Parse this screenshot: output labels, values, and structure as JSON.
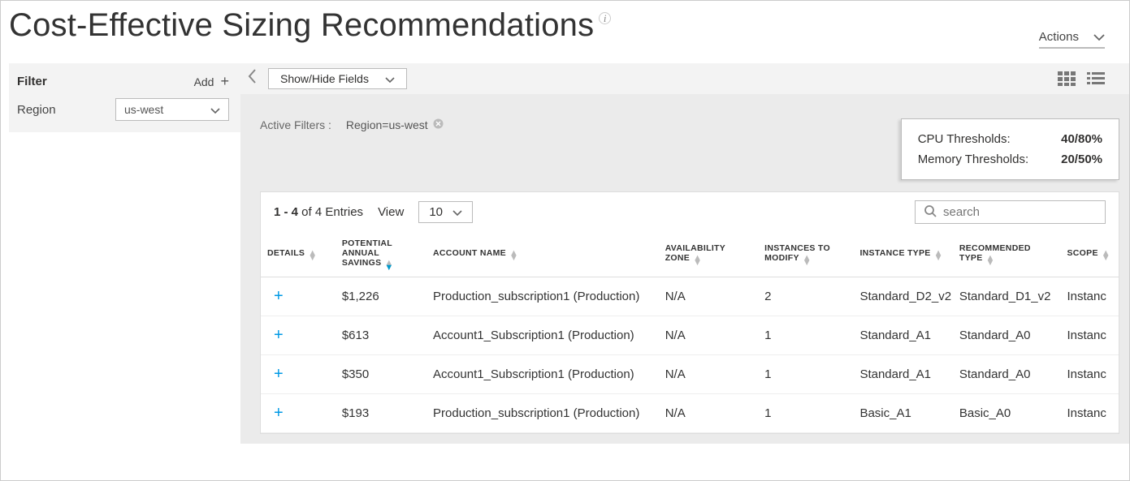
{
  "header": {
    "title": "Cost-Effective Sizing Recommendations",
    "actions_label": "Actions"
  },
  "filter": {
    "title": "Filter",
    "add_label": "Add",
    "region_label": "Region",
    "region_value": "us-west"
  },
  "toolbar": {
    "show_hide_label": "Show/Hide Fields"
  },
  "active_filters": {
    "label": "Active Filters :",
    "tag": "Region=us-west"
  },
  "thresholds": {
    "cpu_label": "CPU Thresholds:",
    "cpu_value": "40/80%",
    "mem_label": "Memory Thresholds:",
    "mem_value": "20/50%"
  },
  "pagination": {
    "range": "1 - 4",
    "of_text": " of 4 Entries",
    "view_label": "View",
    "page_size": "10"
  },
  "search": {
    "placeholder": "search"
  },
  "columns": {
    "details": "DETAILS",
    "savings": "POTENTIAL ANNUAL SAVINGS",
    "account": "ACCOUNT NAME",
    "az": "AVAILABILITY ZONE",
    "instances": "INSTANCES TO MODIFY",
    "type": "INSTANCE TYPE",
    "recommended": "RECOMMENDED TYPE",
    "scope": "SCOPE"
  },
  "rows": [
    {
      "savings": "$1,226",
      "account": "Production_subscription1 (Production)",
      "az": "N/A",
      "instances": "2",
      "type": "Standard_D2_v2",
      "recommended": "Standard_D1_v2",
      "scope": "Instanc"
    },
    {
      "savings": "$613",
      "account": "Account1_Subscription1 (Production)",
      "az": "N/A",
      "instances": "1",
      "type": "Standard_A1",
      "recommended": "Standard_A0",
      "scope": "Instanc"
    },
    {
      "savings": "$350",
      "account": "Account1_Subscription1 (Production)",
      "az": "N/A",
      "instances": "1",
      "type": "Standard_A1",
      "recommended": "Standard_A0",
      "scope": "Instanc"
    },
    {
      "savings": "$193",
      "account": "Production_subscription1 (Production)",
      "az": "N/A",
      "instances": "1",
      "type": "Basic_A1",
      "recommended": "Basic_A0",
      "scope": "Instanc"
    }
  ]
}
